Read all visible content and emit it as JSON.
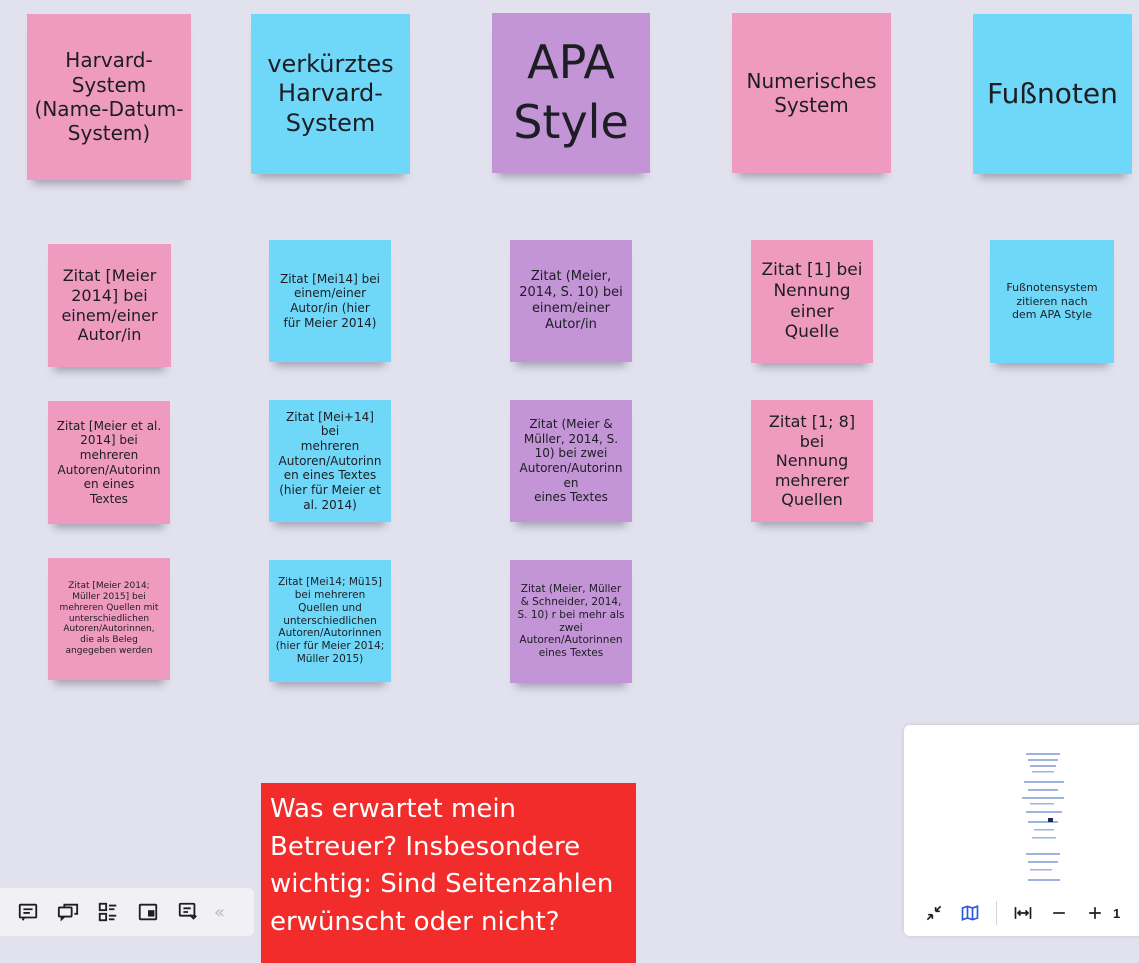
{
  "board": {
    "headers": [
      {
        "text": "Harvard-\nSystem\n(Name-Datum-\nSystem)",
        "color": "pink"
      },
      {
        "text": "verkürztes\nHarvard-\nSystem",
        "color": "cyan"
      },
      {
        "text": "APA\nStyle",
        "color": "purple"
      },
      {
        "text": "Numerisches\nSystem",
        "color": "pink"
      },
      {
        "text": "Fußnoten",
        "color": "cyan"
      }
    ],
    "notes": [
      {
        "text": "Zitat [Meier\n2014] bei\neinem/einer\nAutor/in",
        "color": "pink"
      },
      {
        "text": "Zitat [Mei14] bei\neinem/einer\nAutor/in (hier\nfür Meier 2014)",
        "color": "cyan"
      },
      {
        "text": "Zitat (Meier,\n2014, S. 10) bei\neinem/einer\nAutor/in",
        "color": "purple"
      },
      {
        "text": "Zitat [1]  bei\nNennung\neiner\nQuelle",
        "color": "pink"
      },
      {
        "text": "Fußnotensystem\nzitieren nach\ndem APA Style",
        "color": "cyan"
      },
      {
        "text": "Zitat [Meier et al.\n2014] bei\nmehreren\nAutoren/Autorinn\nen eines\nTextes",
        "color": "pink"
      },
      {
        "text": "Zitat [Mei+14] bei\nmehreren\nAutoren/Autorinn\nen eines Textes\n(hier für Meier et\nal. 2014)",
        "color": "cyan"
      },
      {
        "text": "Zitat (Meier &\nMüller, 2014, S.\n10) bei zwei\nAutoren/Autorinn\nen\neines Textes",
        "color": "purple"
      },
      {
        "text": "Zitat [1; 8] bei\nNennung\nmehrerer\nQuellen",
        "color": "pink"
      },
      {
        "text": "Zitat [Meier 2014;\nMüller 2015] bei\nmehreren Quellen mit\nunterschiedlichen\nAutoren/Autorinnen,\ndie als Beleg\nangegeben werden",
        "color": "pink"
      },
      {
        "text": "Zitat [Mei14; Mü15]\nbei mehreren\nQuellen und\nunterschiedlichen\nAutoren/Autorinnen\n(hier für Meier 2014;\nMüller 2015)",
        "color": "cyan"
      },
      {
        "text": "Zitat (Meier, Müller\n& Schneider, 2014,\nS. 10) r bei mehr als\nzwei\nAutoren/Autorinnen\neines Textes",
        "color": "purple"
      }
    ],
    "question": {
      "text": " Was erwartet mein\nBetreuer? Insbesondere\nwichtig: Sind Seitenzahlen\nerwünscht oder nicht?",
      "color": "red"
    }
  },
  "colors": {
    "pink": "#ef9bc0",
    "cyan": "#6fd8f8",
    "purple": "#c394d6",
    "red": "#f22b2b",
    "background": "#e2e2ee",
    "accent": "#2b58d8"
  },
  "toolbar": {
    "buttons": [
      {
        "icon": "comments-icon"
      },
      {
        "icon": "chat-icon"
      },
      {
        "icon": "outline-list-icon"
      },
      {
        "icon": "frame-icon"
      },
      {
        "icon": "presentation-icon"
      }
    ],
    "collapse_label": "«"
  },
  "minimap": {
    "zoom_label": "1"
  }
}
